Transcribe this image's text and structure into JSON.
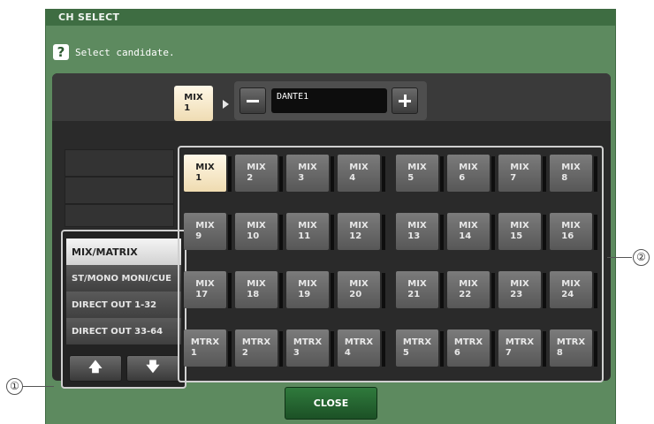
{
  "window": {
    "title": "CH SELECT"
  },
  "prompt": {
    "text": "Select candidate."
  },
  "header": {
    "current_key": "MIX\n1",
    "channel_name": "DANTE1",
    "minus_label": "−",
    "plus_label": "+"
  },
  "categories": [
    {
      "label": "MIX/MATRIX",
      "selected": true
    },
    {
      "label": "ST/MONO\nMONI/CUE",
      "selected": false
    },
    {
      "label": "DIRECT OUT\n1-32",
      "selected": false
    },
    {
      "label": "DIRECT OUT\n33-64",
      "selected": false
    }
  ],
  "scroll": {
    "up": "🡅",
    "down": "🡇"
  },
  "channels": [
    "MIX\n1",
    "MIX\n2",
    "MIX\n3",
    "MIX\n4",
    "MIX\n5",
    "MIX\n6",
    "MIX\n7",
    "MIX\n8",
    "MIX\n9",
    "MIX\n10",
    "MIX\n11",
    "MIX\n12",
    "MIX\n13",
    "MIX\n14",
    "MIX\n15",
    "MIX\n16",
    "MIX\n17",
    "MIX\n18",
    "MIX\n19",
    "MIX\n20",
    "MIX\n21",
    "MIX\n22",
    "MIX\n23",
    "MIX\n24",
    "MTRX\n1",
    "MTRX\n2",
    "MTRX\n3",
    "MTRX\n4",
    "MTRX\n5",
    "MTRX\n6",
    "MTRX\n7",
    "MTRX\n8"
  ],
  "selected_channel": "MIX\n1",
  "close_label": "CLOSE",
  "callouts": {
    "category_list": "①",
    "channel_grid": "②"
  },
  "colors": {
    "window": "#5d8a5f",
    "selected_key": "#f6e8c8",
    "close_button": "#2a6e35"
  }
}
